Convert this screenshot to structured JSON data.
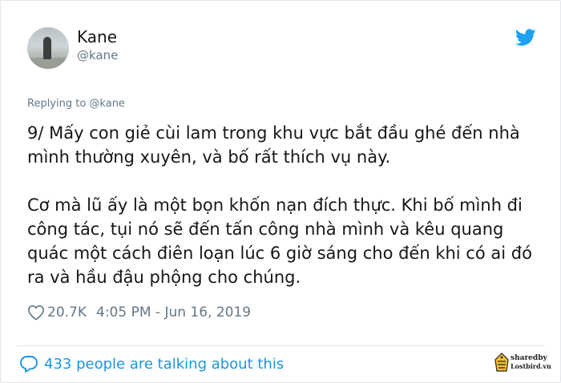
{
  "author": {
    "name": "Kane",
    "handle": "@kane",
    "avatar_icon": "avatar-photo"
  },
  "brand_icon": "twitter-bird-icon",
  "colors": {
    "brand": "#1da1f2",
    "link": "#1b95e0",
    "secondary_text": "#657786",
    "primary_text": "#14171a"
  },
  "replying_to": "Replying to @kane",
  "tweet": {
    "paragraph_1": "9/ Mấy con giẻ cùi lam trong khu vực bắt đầu ghé đến nhà mình thường xuyên, và bố rất thích vụ này.",
    "paragraph_2": "Cơ mà lũ ấy là một bọn khốn nạn đích thực. Khi bố mình đi công tác, tụi nó sẽ đến tấn công nhà mình và kêu quang quác một cách điên loạn lúc 6 giờ sáng cho đến khi có ai đó ra và hầu đậu phộng cho chúng."
  },
  "meta": {
    "likes": "20.7K",
    "timestamp": "4:05 PM - Jun 16, 2019"
  },
  "talking": "433 people are talking about this",
  "watermark": {
    "line1": "sharedby",
    "line2": "Lostbird.vn"
  }
}
